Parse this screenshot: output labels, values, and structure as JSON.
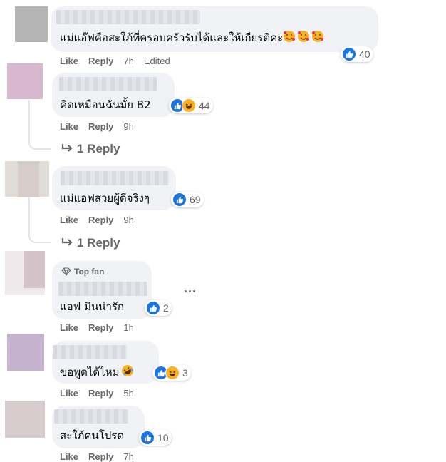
{
  "comments": [
    {
      "text": "แม่แอ๊ฟคือสะใภ้ที่ครอบครัวรับได้และให้เกียรติคะ",
      "emoji": "smiling-face-with-hearts",
      "actions": {
        "like": "Like",
        "reply": "Reply",
        "time": "7h",
        "edited": "Edited"
      },
      "reaction_count": "40",
      "reactions": [
        "like"
      ]
    },
    {
      "text": "คิดเหมือนฉันมั้ย B2",
      "actions": {
        "like": "Like",
        "reply": "Reply",
        "time": "9h"
      },
      "reaction_count": "44",
      "reactions": [
        "like",
        "haha"
      ],
      "replies_link": "1 Reply"
    },
    {
      "text": "แม่แอฟสวยผู้ดีจริงๆ",
      "actions": {
        "like": "Like",
        "reply": "Reply",
        "time": "9h"
      },
      "reaction_count": "69",
      "reactions": [
        "like"
      ],
      "replies_link": "1 Reply"
    },
    {
      "badge": "Top fan",
      "text": "แอฟ มินน่ารัก",
      "actions": {
        "like": "Like",
        "reply": "Reply",
        "time": "1h"
      },
      "reaction_count": "2",
      "reactions": [
        "like"
      ],
      "more": "..."
    },
    {
      "text": "ขอพูดได้ไหม",
      "emoji": "rolling-on-floor-laughing",
      "actions": {
        "like": "Like",
        "reply": "Reply",
        "time": "5h"
      },
      "reaction_count": "3",
      "reactions": [
        "like",
        "haha"
      ]
    },
    {
      "text": "สะใภ้คนโปรด",
      "actions": {
        "like": "Like",
        "reply": "Reply",
        "time": "7h"
      },
      "reaction_count": "10",
      "reactions": [
        "like"
      ]
    }
  ],
  "colors": {
    "bubble": "#f0f2f5",
    "like_blue": "#1b74e4",
    "haha_yellow": "#f7b125",
    "meta_gray": "#65676b"
  }
}
